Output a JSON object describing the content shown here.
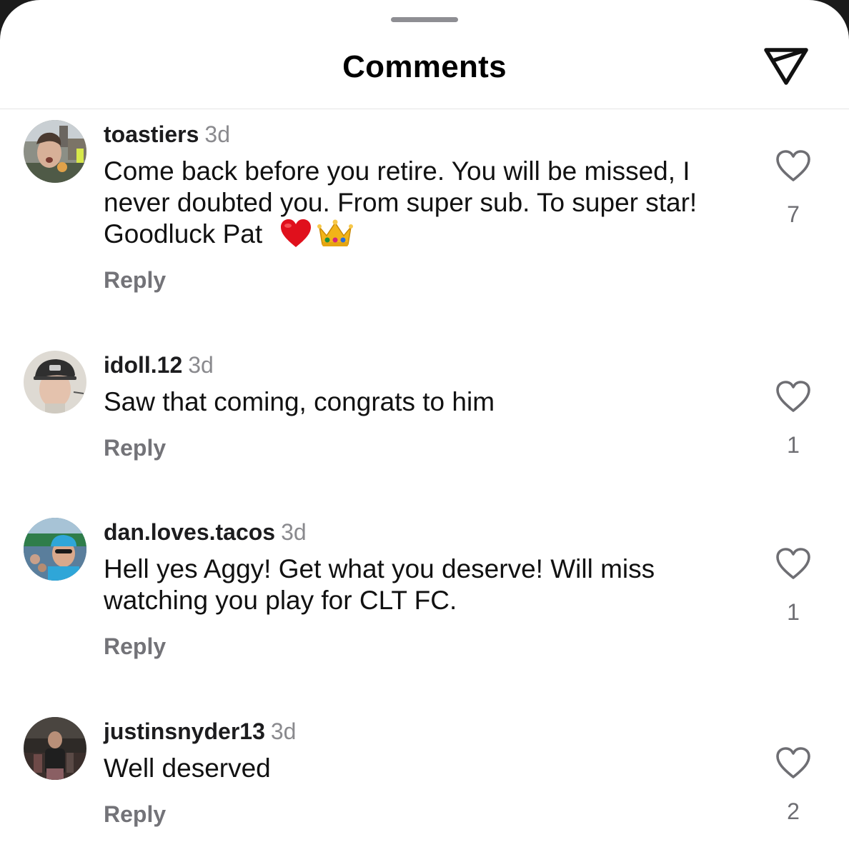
{
  "header": {
    "title": "Comments",
    "share_icon": "paper-plane-icon"
  },
  "comments": [
    {
      "username": "toastiers",
      "time": "3d",
      "text": "Come back before you retire. You will be missed, I never doubted you. From super sub. To super star! Goodluck Pat",
      "emojis": [
        "red-heart",
        "crown"
      ],
      "reply_label": "Reply",
      "likes": "7"
    },
    {
      "username": "idoll.12",
      "time": "3d",
      "text": "Saw that coming, congrats to him",
      "reply_label": "Reply",
      "likes": "1"
    },
    {
      "username": "dan.loves.tacos",
      "time": "3d",
      "text": "Hell yes Aggy! Get what you deserve! Will miss watching you play for CLT FC.",
      "reply_label": "Reply",
      "likes": "1"
    },
    {
      "username": "justinsnyder13",
      "time": "3d",
      "text": "Well deserved",
      "reply_label": "Reply",
      "likes": "2"
    }
  ],
  "colors": {
    "background": "#ffffff",
    "username": "#1c1c1e",
    "secondary": "#8a8a8e",
    "reply": "#737378"
  }
}
